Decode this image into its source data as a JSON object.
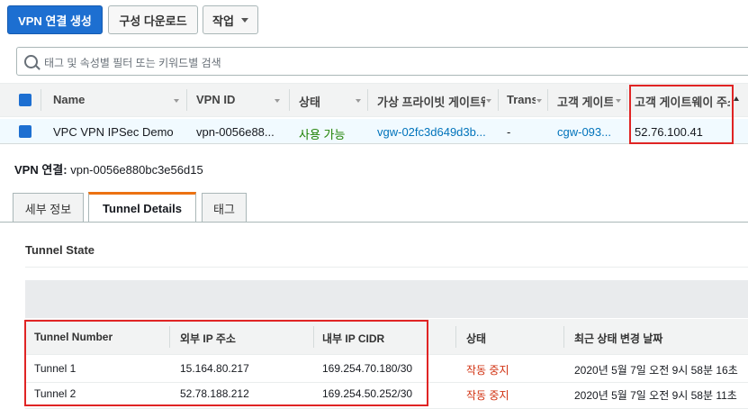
{
  "toolbar": {
    "create_vpn": "VPN 연결 생성",
    "download_config": "구성 다운로드",
    "actions": "작업"
  },
  "search": {
    "placeholder": "태그 및 속성별 필터 또는 키워드별 검색"
  },
  "grid": {
    "columns": [
      "Name",
      "VPN ID",
      "상태",
      "가상 프라이빗 게이트웨",
      "Trans",
      "고객 게이트",
      "고객 게이트웨이 주소"
    ],
    "row": {
      "name": "VPC VPN IPSec Demo",
      "vpn_id": "vpn-0056e88...",
      "state": "사용 가능",
      "vgw": "vgw-02fc3d649d3b...",
      "transit": "-",
      "cgw": "cgw-093...",
      "cgw_address": "52.76.100.41"
    }
  },
  "detail": {
    "label": "VPN 연결:",
    "value": "vpn-0056e880bc3e56d15"
  },
  "tabs": [
    "세부 정보",
    "Tunnel Details",
    "태그"
  ],
  "tunnel_state": {
    "title": "Tunnel State",
    "columns": [
      "Tunnel Number",
      "외부 IP 주소",
      "내부 IP CIDR",
      "상태",
      "최근 상태 변경 날짜"
    ],
    "rows": [
      {
        "number": "Tunnel 1",
        "outside_ip": "15.164.80.217",
        "inside_cidr": "169.254.70.180/30",
        "status": "작동 중지",
        "changed": "2020년 5월 7일 오전 9시 58분 16초"
      },
      {
        "number": "Tunnel 2",
        "outside_ip": "52.78.188.212",
        "inside_cidr": "169.254.50.252/30",
        "status": "작동 중지",
        "changed": "2020년 5월 7일 오전 9시 58분 11초"
      }
    ]
  },
  "colors": {
    "primary": "#1d6fd1",
    "highlight_box": "#e02424",
    "status_stopped": "#d13212",
    "status_available": "#1d8102",
    "tab_accent": "#ec7211"
  }
}
